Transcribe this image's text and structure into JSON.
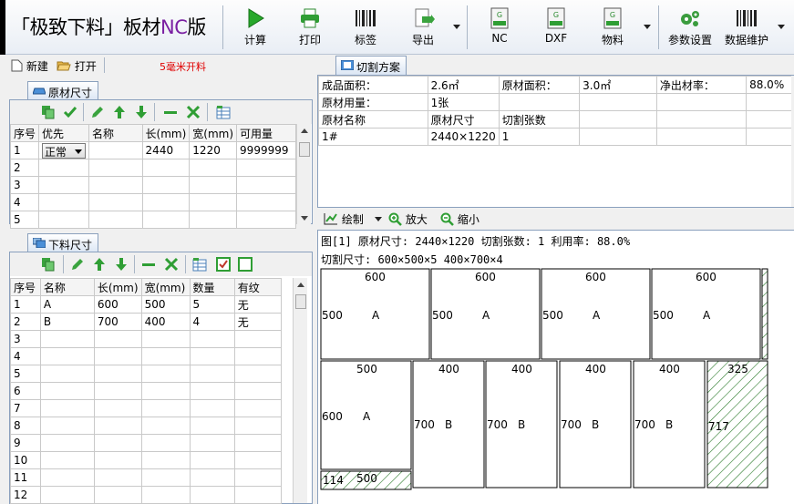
{
  "app": {
    "title_prefix": "「极致下料」板材",
    "title_nc": "NC",
    "title_suffix": "版"
  },
  "toolbar": {
    "items": [
      {
        "label": "计算",
        "icon": "play-icon"
      },
      {
        "label": "打印",
        "icon": "printer-icon"
      },
      {
        "label": "标签",
        "icon": "barcode-icon"
      },
      {
        "label": "导出",
        "icon": "export-icon"
      },
      {
        "label": "NC",
        "icon": "gcode-icon"
      },
      {
        "label": "DXF",
        "icon": "dxf-icon"
      },
      {
        "label": "物料",
        "icon": "material-icon"
      },
      {
        "label": "参数设置",
        "icon": "gears-icon"
      },
      {
        "label": "数据维护",
        "icon": "barcode-icon"
      }
    ]
  },
  "file_bar": {
    "new_label": "新建",
    "open_label": "打开",
    "hint": "5毫米开料"
  },
  "raw_panel": {
    "tab_label": "原材尺寸",
    "columns": [
      "序号",
      "优先",
      "名称",
      "长(mm)",
      "宽(mm)",
      "可用量"
    ],
    "rows": [
      [
        "1",
        "正常",
        "",
        "2440",
        "1220",
        "9999999"
      ],
      [
        "2",
        "",
        "",
        "",
        "",
        ""
      ],
      [
        "3",
        "",
        "",
        "",
        "",
        ""
      ],
      [
        "4",
        "",
        "",
        "",
        "",
        ""
      ],
      [
        "5",
        "",
        "",
        "",
        "",
        ""
      ]
    ]
  },
  "cut_panel": {
    "tab_label": "下料尺寸",
    "columns": [
      "序号",
      "名称",
      "长(mm)",
      "宽(mm)",
      "数量",
      "有纹"
    ],
    "rows": [
      [
        "1",
        "A",
        "600",
        "500",
        "5",
        "无"
      ],
      [
        "2",
        "B",
        "700",
        "400",
        "4",
        "无"
      ],
      [
        "3",
        "",
        "",
        "",
        "",
        ""
      ],
      [
        "4",
        "",
        "",
        "",
        "",
        ""
      ],
      [
        "5",
        "",
        "",
        "",
        "",
        ""
      ],
      [
        "6",
        "",
        "",
        "",
        "",
        ""
      ],
      [
        "7",
        "",
        "",
        "",
        "",
        ""
      ],
      [
        "8",
        "",
        "",
        "",
        "",
        ""
      ],
      [
        "9",
        "",
        "",
        "",
        "",
        ""
      ],
      [
        "10",
        "",
        "",
        "",
        "",
        ""
      ],
      [
        "11",
        "",
        "",
        "",
        "",
        ""
      ],
      [
        "12",
        "",
        "",
        "",
        "",
        ""
      ]
    ]
  },
  "plan_panel": {
    "tab_label": "切割方案",
    "summary": [
      [
        "成品面积：",
        "2.6㎡",
        "原材面积：",
        "3.0㎡",
        "净出材率：",
        "88.0%"
      ],
      [
        "原材用量：",
        "1张",
        "",
        "",
        "",
        ""
      ],
      [
        "原材名称",
        "原材尺寸",
        "切割张数",
        "",
        "",
        ""
      ],
      [
        "1#",
        "2440×1220",
        "1",
        "",
        "",
        ""
      ]
    ]
  },
  "draw_bar": {
    "draw_label": "绘制",
    "zoom_in_label": "放大",
    "zoom_out_label": "缩小"
  },
  "drawing": {
    "line1": "图[1] 原材尺寸: 2440×1220  切割张数: 1  利用率: 88.0%",
    "line2": "切割尺寸: 600×500×5 400×700×4",
    "pieces_row1": [
      {
        "w": "600",
        "h": "500",
        "name": "A"
      },
      {
        "w": "600",
        "h": "500",
        "name": "A"
      },
      {
        "w": "600",
        "h": "500",
        "name": "A"
      },
      {
        "w": "600",
        "h": "500",
        "name": "A"
      }
    ],
    "piece_row2_a": {
      "w": "500",
      "h": "600",
      "name": "A"
    },
    "pieces_row2_b": [
      {
        "w": "400",
        "h": "700",
        "name": "B"
      },
      {
        "w": "400",
        "h": "700",
        "name": "B"
      },
      {
        "w": "400",
        "h": "700",
        "name": "B"
      },
      {
        "w": "400",
        "h": "700",
        "name": "B"
      }
    ],
    "waste_right": {
      "w": "325",
      "h": "717"
    },
    "waste_bottom": {
      "w": "500",
      "h": "114"
    }
  }
}
